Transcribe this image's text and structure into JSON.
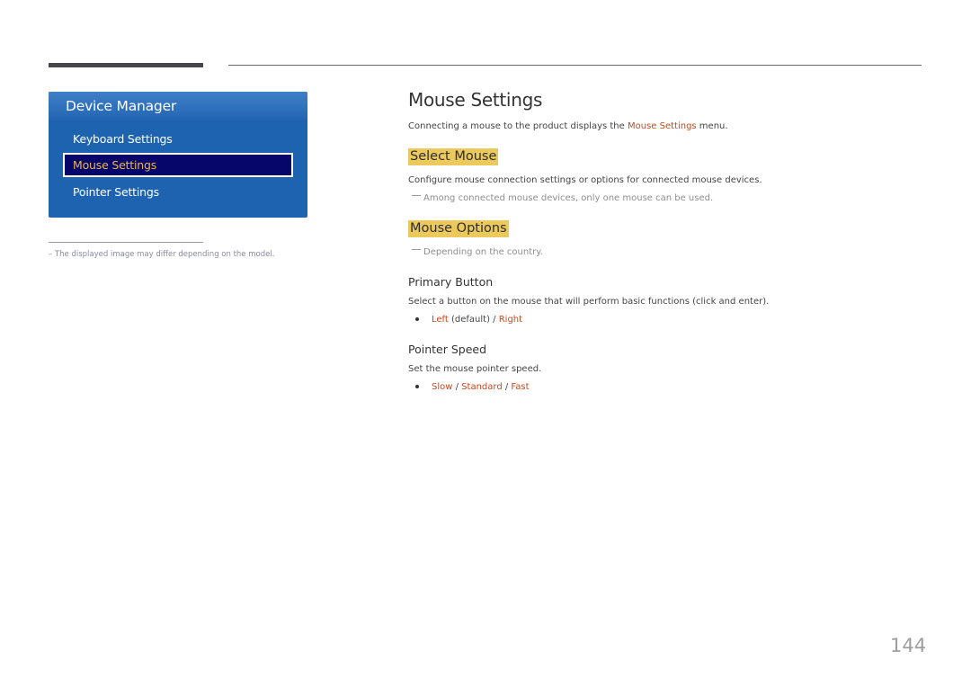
{
  "sidebar": {
    "title": "Device Manager",
    "items": [
      {
        "label": "Keyboard Settings",
        "selected": false
      },
      {
        "label": "Mouse Settings",
        "selected": true
      },
      {
        "label": "Pointer Settings",
        "selected": false
      }
    ],
    "footnote": "–  The displayed image may differ depending on the model."
  },
  "main": {
    "title": "Mouse Settings",
    "intro_prefix": "Connecting a mouse to the product displays the ",
    "intro_link": "Mouse Settings",
    "intro_suffix": " menu.",
    "sections": [
      {
        "heading": "Select Mouse",
        "description": "Configure mouse connection settings or options for connected mouse devices.",
        "note": "Among connected mouse devices, only one mouse can be used."
      },
      {
        "heading": "Mouse Options",
        "note": "Depending on the country."
      }
    ],
    "primary_button": {
      "heading": "Primary Button",
      "description": "Select a button on the mouse that will perform basic functions (click and enter).",
      "option_left": "Left",
      "option_default": " (default) / ",
      "option_right": "Right"
    },
    "pointer_speed": {
      "heading": "Pointer Speed",
      "description": "Set the mouse pointer speed.",
      "options": [
        "Slow",
        "Standard",
        "Fast"
      ],
      "separator": " / "
    }
  },
  "colors": {
    "panel_blue": "#1e63b0",
    "selected_bg": "#05056a",
    "selected_text": "#e8b84a",
    "highlight": "#ebc95c",
    "link_red": "#c6491f"
  },
  "page_number": "144"
}
